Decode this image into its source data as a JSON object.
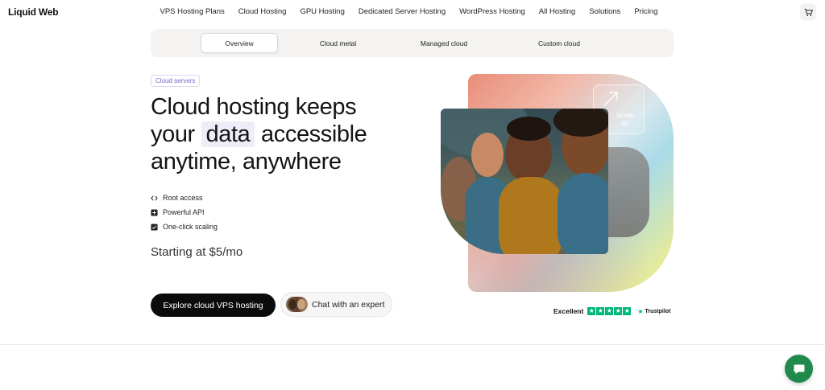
{
  "brand": {
    "name": "Liquid Web"
  },
  "nav": {
    "items": [
      {
        "label": "VPS Hosting Plans"
      },
      {
        "label": "Cloud Hosting"
      },
      {
        "label": "GPU Hosting"
      },
      {
        "label": "Dedicated Server Hosting"
      },
      {
        "label": "WordPress Hosting"
      },
      {
        "label": "All Hosting"
      },
      {
        "label": "Solutions"
      },
      {
        "label": "Pricing"
      }
    ],
    "cart_icon": "cart-icon"
  },
  "subnav": {
    "tabs": [
      {
        "label": "Overview",
        "active": true
      },
      {
        "label": "Cloud metal",
        "active": false
      },
      {
        "label": "Managed cloud",
        "active": false
      },
      {
        "label": "Custom cloud",
        "active": false
      }
    ]
  },
  "hero": {
    "badge": "Cloud servers",
    "headline_before": "Cloud hosting keeps your",
    "headline_highlight": "data",
    "headline_after": "accessible anytime, anywhere",
    "features": [
      {
        "icon": "code-icon",
        "label": "Root access"
      },
      {
        "icon": "plus-box-icon",
        "label": "Powerful API"
      },
      {
        "icon": "check-box-icon",
        "label": "One-click scaling"
      }
    ],
    "price": "Starting at $5/mo",
    "primary_cta": "Explore cloud VPS hosting",
    "secondary_cta": "Chat with an expert",
    "scale_label_1": "Scale",
    "scale_label_2": "up"
  },
  "trust": {
    "label": "Excellent",
    "stars": 5,
    "provider": "Trustpilot"
  },
  "colors": {
    "accent_purple": "#7a62c9",
    "trustpilot_green": "#00b67a",
    "chat_green": "#1f8a4c"
  }
}
